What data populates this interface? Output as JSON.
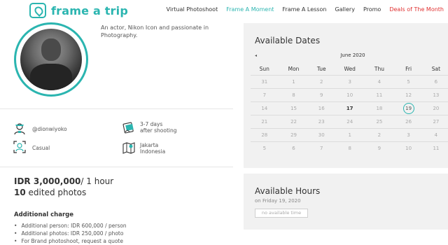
{
  "header": {
    "logo_text": "frame a trip",
    "nav": [
      {
        "label": "Virtual Photoshoot",
        "style": "normal"
      },
      {
        "label": "Frame A Moment",
        "style": "active"
      },
      {
        "label": "Frame A Lesson",
        "style": "normal"
      },
      {
        "label": "Gallery",
        "style": "normal"
      },
      {
        "label": "Promo",
        "style": "normal"
      },
      {
        "label": "Deals of The Month",
        "style": "deals"
      }
    ]
  },
  "profile": {
    "bio": "An actor, Nikon Icon and passionate in Photography.",
    "avatar_icon": "photographer-portrait"
  },
  "details": {
    "username": "@dionwiyoko",
    "delivery_line1": "3-7 days",
    "delivery_line2": "after shooting",
    "style": "Casual",
    "location_line1": "Jakarta",
    "location_line2": "Indonesia"
  },
  "pricing": {
    "price": "IDR 3,000,000",
    "unit": "/ 1 hour",
    "photos_count": "10",
    "photos_label": "edited photos",
    "additional_title": "Additional charge",
    "additional_items": [
      "Additional person: IDR 600,000 / person",
      "Additional photos: IDR 250,000 / photo",
      "For Brand photoshoot, request a quote"
    ]
  },
  "available_dates": {
    "title": "Available Dates",
    "prev_arrow": "◂",
    "month": "June 2020",
    "weekdays": [
      "Sun",
      "Mon",
      "Tue",
      "Wed",
      "Thu",
      "Fri",
      "Sat"
    ],
    "weeks": [
      [
        "31",
        "1",
        "2",
        "3",
        "4",
        "5",
        "6"
      ],
      [
        "7",
        "8",
        "9",
        "10",
        "11",
        "12",
        "13"
      ],
      [
        "14",
        "15",
        "16",
        "17",
        "18",
        "19",
        "20"
      ],
      [
        "21",
        "22",
        "23",
        "24",
        "25",
        "26",
        "27"
      ],
      [
        "28",
        "29",
        "30",
        "1",
        "2",
        "3",
        "4"
      ],
      [
        "5",
        "6",
        "7",
        "8",
        "9",
        "10",
        "11"
      ]
    ],
    "today": "17",
    "selected": "19"
  },
  "available_hours": {
    "title": "Available Hours",
    "subtitle": "on Friday 19, 2020",
    "no_time": "no available time"
  },
  "colors": {
    "accent": "#2bb5b0",
    "deals": "#e03030",
    "panel_bg": "#f1f1f1"
  }
}
